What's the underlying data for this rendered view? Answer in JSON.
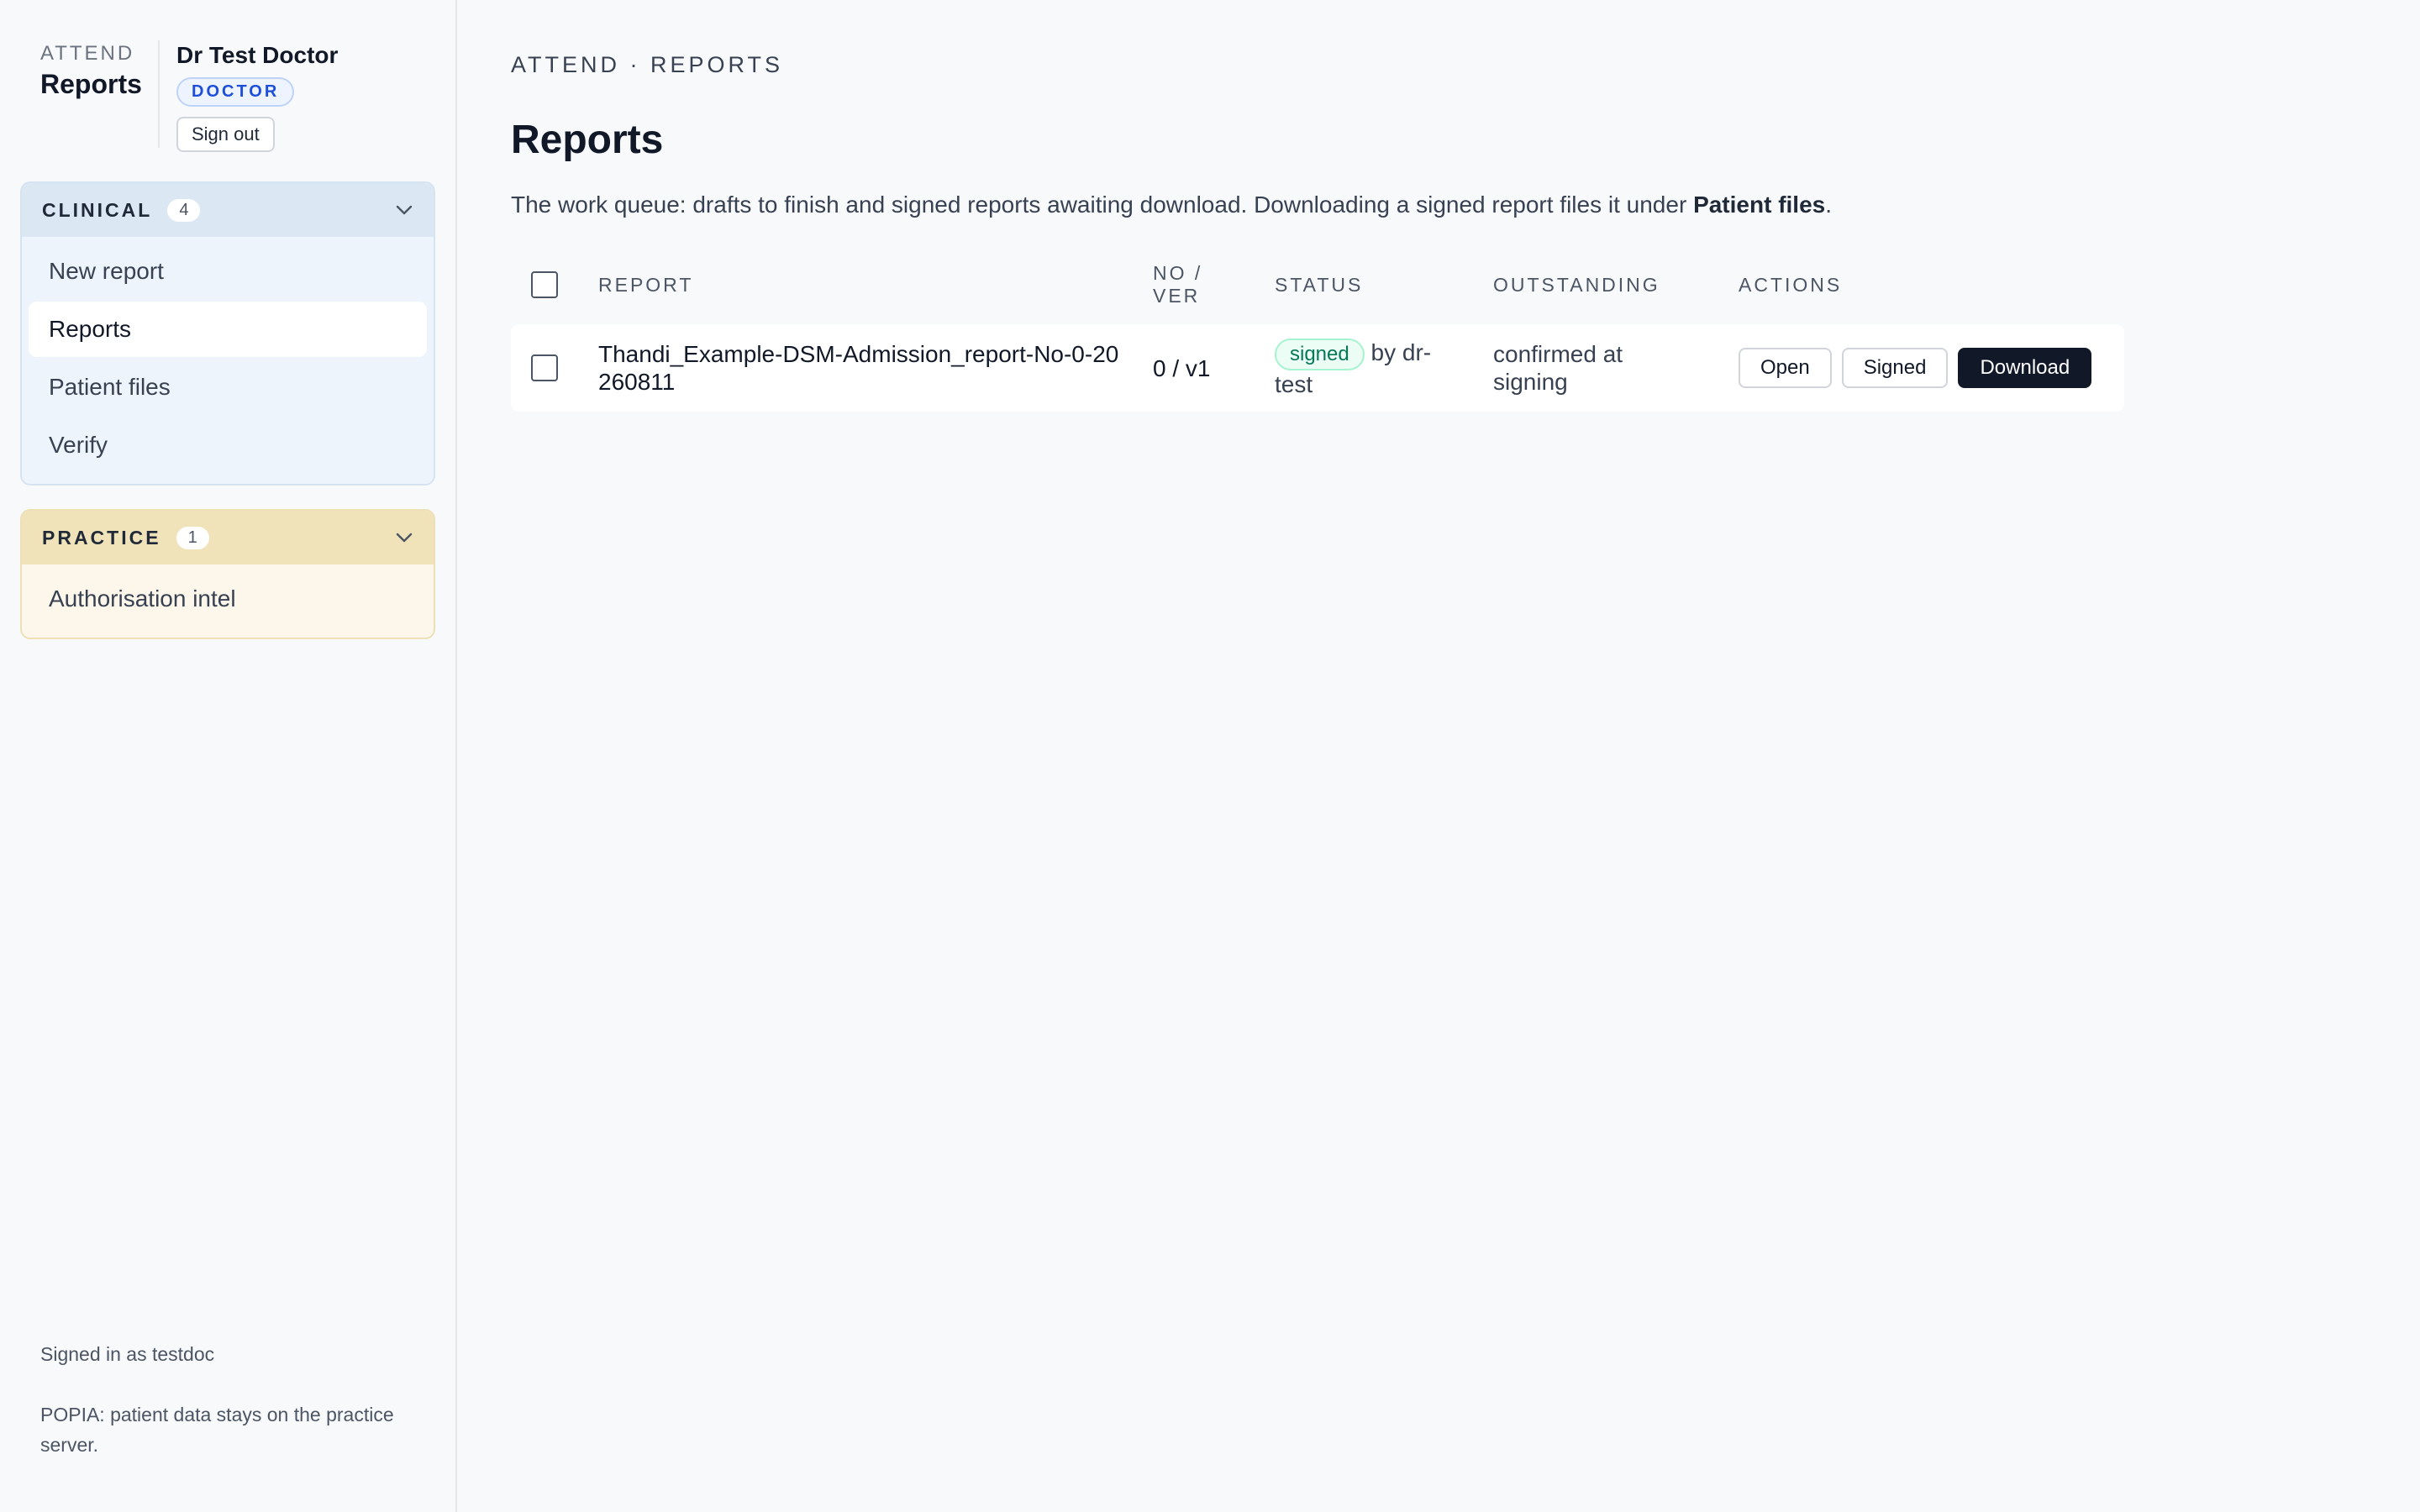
{
  "brand": {
    "app": "ATTEND",
    "page": "Reports"
  },
  "user": {
    "name": "Dr Test Doctor",
    "role": "DOCTOR",
    "sign_out": "Sign out"
  },
  "sidebar": {
    "groups": [
      {
        "title": "CLINICAL",
        "count": "4",
        "items": [
          {
            "label": "New report"
          },
          {
            "label": "Reports",
            "active": true
          },
          {
            "label": "Patient files"
          },
          {
            "label": "Verify"
          }
        ]
      },
      {
        "title": "PRACTICE",
        "count": "1",
        "items": [
          {
            "label": "Authorisation intel"
          }
        ]
      }
    ],
    "footer": {
      "signed_in": "Signed in as testdoc",
      "popia": "POPIA: patient data stays on the practice server."
    }
  },
  "main": {
    "breadcrumb": "ATTEND · REPORTS",
    "title": "Reports",
    "intro_text": "The work queue: drafts to finish and signed reports awaiting download. Downloading a signed report files it under ",
    "intro_bold": "Patient files",
    "intro_end": ".",
    "table": {
      "headers": {
        "report": "REPORT",
        "no_ver": "NO / VER",
        "status": "STATUS",
        "outstanding": "OUTSTANDING",
        "actions": "ACTIONS"
      },
      "rows": [
        {
          "report": "Thandi_Example-DSM-Admission_report-No-0-20260811",
          "no_ver": "0 / v1",
          "status_badge": "signed",
          "status_by": "by dr-test",
          "outstanding": "confirmed at signing",
          "actions": {
            "open": "Open",
            "signed": "Signed",
            "download": "Download"
          }
        }
      ]
    }
  }
}
